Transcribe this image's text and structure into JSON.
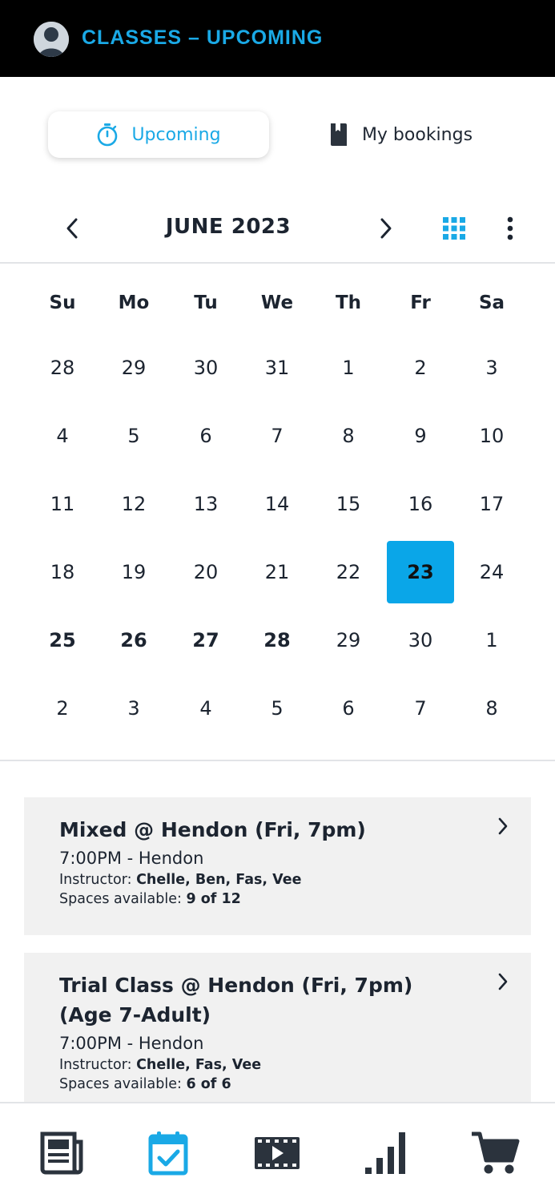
{
  "header": {
    "title": "CLASSES – UPCOMING"
  },
  "tabs": [
    {
      "label": "Upcoming",
      "icon": "stopwatch-icon",
      "active": true
    },
    {
      "label": "My bookings",
      "icon": "bookmark-book-icon",
      "active": false
    }
  ],
  "calendar": {
    "month_label": "JUNE 2023",
    "weekdays": [
      "Su",
      "Mo",
      "Tu",
      "We",
      "Th",
      "Fr",
      "Sa"
    ],
    "weeks": [
      [
        "28",
        "29",
        "30",
        "31",
        "1",
        "2",
        "3"
      ],
      [
        "4",
        "5",
        "6",
        "7",
        "8",
        "9",
        "10"
      ],
      [
        "11",
        "12",
        "13",
        "14",
        "15",
        "16",
        "17"
      ],
      [
        "18",
        "19",
        "20",
        "21",
        "22",
        "23",
        "24"
      ],
      [
        "25",
        "26",
        "27",
        "28",
        "29",
        "30",
        "1"
      ],
      [
        "2",
        "3",
        "4",
        "5",
        "6",
        "7",
        "8"
      ]
    ],
    "selected_day": "23",
    "bold_days": [
      "25",
      "26",
      "27",
      "28"
    ],
    "accent_color": "#0aa6e8"
  },
  "classes": [
    {
      "title": "Mixed @ Hendon (Fri, 7pm)",
      "time_location": "7:00PM - Hendon",
      "instructor_label": "Instructor:",
      "instructors": "Chelle, Ben, Fas, Vee",
      "spaces_label": "Spaces available:",
      "spaces": "9 of 12"
    },
    {
      "title": "Trial Class @ Hendon (Fri, 7pm) (Age 7-Adult)",
      "time_location": "7:00PM - Hendon",
      "instructor_label": "Instructor:",
      "instructors": "Chelle, Fas, Vee",
      "spaces_label": "Spaces available:",
      "spaces": "6 of 6"
    }
  ],
  "bottom_nav": [
    {
      "icon": "newspaper-icon",
      "active": false
    },
    {
      "icon": "calendar-check-icon",
      "active": true
    },
    {
      "icon": "video-icon",
      "active": false
    },
    {
      "icon": "bar-chart-icon",
      "active": false
    },
    {
      "icon": "cart-icon",
      "active": false
    }
  ],
  "colors": {
    "brand": "#1aa9e6",
    "topbar": "#000000",
    "text": "#1c2430",
    "card_bg": "#f1f1f1"
  }
}
